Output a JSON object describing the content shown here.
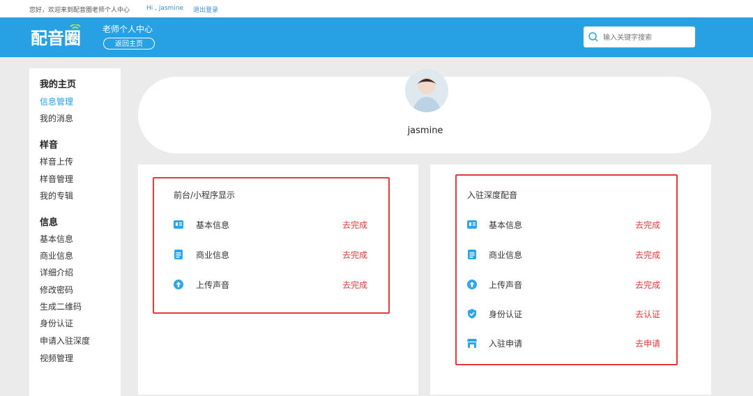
{
  "topbar": {
    "greeting": "您好，欢迎来到配音圈老师个人中心",
    "hi_user": "Hi , jasmine",
    "logout": "退出登录"
  },
  "header": {
    "logo_text": "配音圈",
    "center_title": "老师个人中心",
    "back_home": "返回主页",
    "search_placeholder": "输入关键字搜索"
  },
  "sidebar": {
    "groups": [
      {
        "title": "我的主页",
        "items": [
          "信息管理",
          "我的消息"
        ]
      },
      {
        "title": "样音",
        "items": [
          "样音上传",
          "样音管理",
          "我的专辑"
        ]
      },
      {
        "title": "信息",
        "items": [
          "基本信息",
          "商业信息",
          "详细介绍",
          "修改密码",
          "生成二维码",
          "身份认证",
          "申请入驻深度",
          "视频管理"
        ]
      }
    ],
    "active_item": "信息管理"
  },
  "profile": {
    "username": "jasmine"
  },
  "card_left": {
    "title": "前台/小程序显示",
    "rows": [
      {
        "icon": "id-card-icon",
        "label": "基本信息",
        "action": "去完成"
      },
      {
        "icon": "document-icon",
        "label": "商业信息",
        "action": "去完成"
      },
      {
        "icon": "upload-icon",
        "label": "上传声音",
        "action": "去完成"
      }
    ]
  },
  "card_right": {
    "title": "入驻深度配音",
    "rows": [
      {
        "icon": "id-card-icon",
        "label": "基本信息",
        "action": "去完成"
      },
      {
        "icon": "document-icon",
        "label": "商业信息",
        "action": "去完成"
      },
      {
        "icon": "upload-icon",
        "label": "上传声音",
        "action": "去完成"
      },
      {
        "icon": "shield-check-icon",
        "label": "身份认证",
        "action": "去认证"
      },
      {
        "icon": "store-icon",
        "label": "入驻申请",
        "action": "去申请"
      }
    ]
  },
  "colors": {
    "brand": "#27a0e4",
    "alert": "#e03a3a",
    "link": "#3a8fd6"
  }
}
